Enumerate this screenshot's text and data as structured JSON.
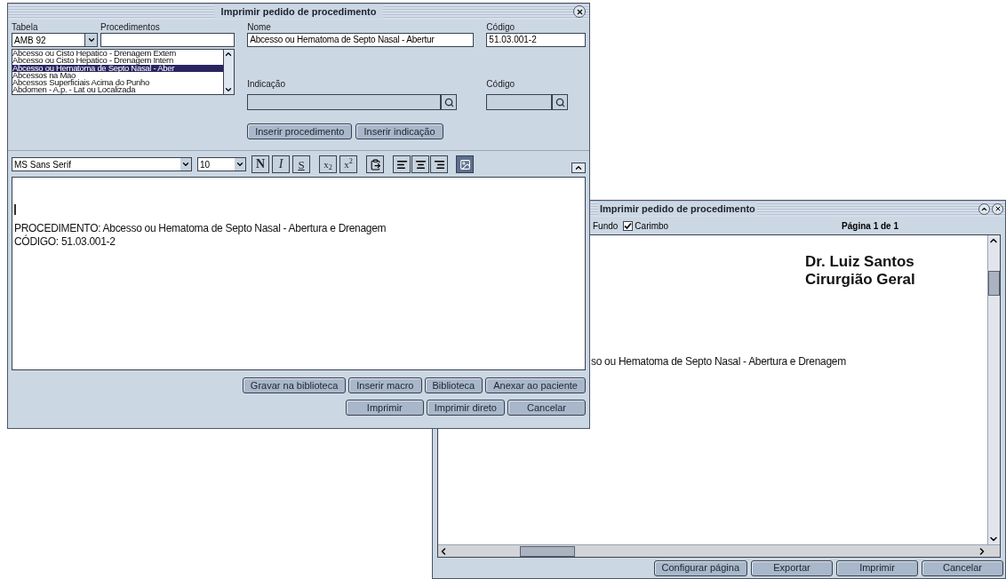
{
  "print_dialog": {
    "title": "Imprimir pedido de procedimento",
    "tabela": {
      "label": "Tabela",
      "value": "AMB 92"
    },
    "procedimentos": {
      "label": "Procedimentos"
    },
    "nome": {
      "label": "Nome",
      "value": "Abcesso ou Hematoma de Septo Nasal - Abertur"
    },
    "codigo": {
      "label": "Código",
      "value": "51.03.001-2"
    },
    "procedure_list": [
      {
        "label": "Abcesso ou Cisto Hepatico - Drenagem Extern",
        "selected": false
      },
      {
        "label": "Abcesso ou Cisto Hepatico - Drenagem Intern",
        "selected": false
      },
      {
        "label": "Abcesso ou Hematoma de Septo Nasal - Aber",
        "selected": true
      },
      {
        "label": "Abcessos na Mao",
        "selected": false
      },
      {
        "label": "Abcessos Superficiais Acima do Punho",
        "selected": false
      },
      {
        "label": "Abdomen - A.p. - Lat ou Localizada",
        "selected": false
      }
    ],
    "indicacao": {
      "label": "Indicação"
    },
    "codigo_indicacao": {
      "label": "Código"
    },
    "insert_buttons": [
      "Inserir procedimento",
      "Inserir indicação"
    ],
    "toolbar": {
      "font": "MS Sans Serif",
      "size": "10",
      "format_buttons": [
        {
          "label": "N",
          "kind": "bold"
        },
        {
          "label": "I",
          "kind": "italic"
        },
        {
          "label": "S",
          "kind": "underline"
        },
        {
          "label": "x$_{2}$",
          "kind": "subscript"
        },
        {
          "label": "x$^{2}$",
          "kind": "superscript"
        }
      ]
    },
    "editor_lines": [
      "PROCEDIMENTO: Abcesso ou Hematoma de Septo Nasal - Abertura e Drenagem",
      "CÓDIGO: 51.03.001-2"
    ],
    "buttons_row1": [
      "Gravar na biblioteca",
      "Inserir macro",
      "Biblioteca",
      "Anexar ao paciente"
    ],
    "buttons_row2": [
      "Imprimir",
      "Imprimir direto",
      "Cancelar"
    ]
  },
  "preview_window": {
    "title": "Imprimir pedido de procedimento",
    "fundo": {
      "label": "Fundo"
    },
    "carimbo": {
      "label": "Carimbo",
      "checked": true
    },
    "page_label": "Página 1 de 1",
    "header_lines": [
      "Dr. Luiz Santos",
      "Cirurgião Geral"
    ],
    "body_line": "so ou Hematoma de Septo Nasal - Abertura e Drenagem",
    "buttons": [
      "Configurar página",
      "Exportar",
      "Imprimir",
      "Cancelar"
    ]
  }
}
